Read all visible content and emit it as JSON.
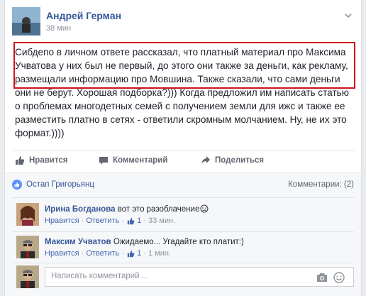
{
  "post": {
    "author": "Андрей Герман",
    "time": "38 мин",
    "text": "Сибдепо в личном ответе рассказал, что платный материал про Максима Учватова у них был не первый, до этого они также за деньги, как рекламу, размещали информацию про Мовшина. Также сказали, что сами деньги они не берут. Хорошая подборка?))) Когда предложил им написать статью о проблемах многодетных семей с получением земли для ижс и также ее разместить платно в сетях - ответили скромным молчанием. Ну, не их это формат.))))"
  },
  "actions": {
    "like": "Нравится",
    "comment": "Комментарий",
    "share": "Поделиться"
  },
  "likes": {
    "likers": "Остап Григорьянц",
    "comments_count": "Комментарии: (2)"
  },
  "comments": [
    {
      "name": "Ирина Богданова",
      "text": "вот это разоблачение",
      "like": "Нравится",
      "reply": "Ответить",
      "like_count": "1",
      "time": "33 мин."
    },
    {
      "name": "Максим Учватов",
      "text": "Ожидаемо... Угадайте кто платит:)",
      "like": "Нравится",
      "reply": "Ответить",
      "like_count": "1",
      "time": "1 мин."
    }
  ],
  "composer": {
    "placeholder": "Написать комментарий ..."
  },
  "colors": {
    "link": "#365899",
    "highlight_border": "#d0121b",
    "like_badge": "#5890ff"
  }
}
